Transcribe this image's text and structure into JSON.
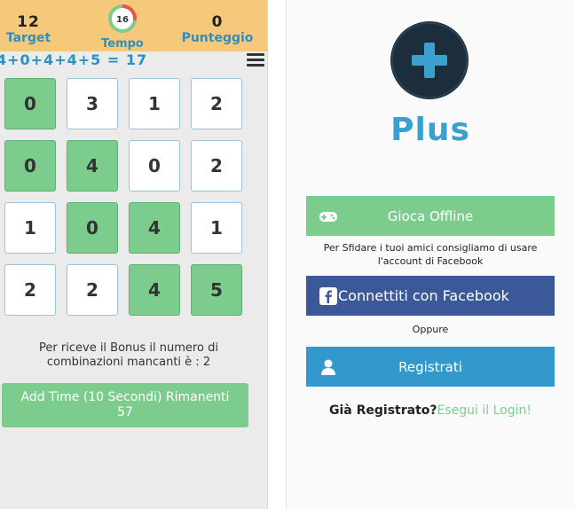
{
  "header": {
    "target_value": "12",
    "target_label": "Target",
    "timer_value": "16",
    "timer_label": "Tempo",
    "timer_fraction": 0.27,
    "score_value": "0",
    "score_label": "Punteggio"
  },
  "equation": "4+0+4+4+5 = 17",
  "grid": [
    [
      {
        "v": "0",
        "on": true
      },
      {
        "v": "3",
        "on": false
      },
      {
        "v": "1",
        "on": false
      },
      {
        "v": "2",
        "on": false
      }
    ],
    [
      {
        "v": "0",
        "on": true
      },
      {
        "v": "4",
        "on": true
      },
      {
        "v": "0",
        "on": false
      },
      {
        "v": "2",
        "on": false
      }
    ],
    [
      {
        "v": "1",
        "on": false
      },
      {
        "v": "0",
        "on": true
      },
      {
        "v": "4",
        "on": true
      },
      {
        "v": "1",
        "on": false
      }
    ],
    [
      {
        "v": "2",
        "on": false
      },
      {
        "v": "2",
        "on": false
      },
      {
        "v": "4",
        "on": true
      },
      {
        "v": "5",
        "on": true
      }
    ]
  ],
  "bonus": {
    "line1": "Per riceve il Bonus il numero di",
    "line2": "combinazioni mancanti è : 2"
  },
  "add_time": {
    "line1": "Add Time (10 Secondi) Rimanenti",
    "line2": "57"
  },
  "right": {
    "app_name": "Plus",
    "offline_button": "Gioca Offline",
    "offline_note_1": "Per Sfidare i tuoi amici consigliamo di usare",
    "offline_note_2": "l'account di Facebook",
    "facebook_button": "Connettiti con Facebook",
    "oppure": "Oppure",
    "register_button": "Registrati",
    "already_registered": "Già Registrato?",
    "login_link": "Esegui il Login!"
  },
  "colors": {
    "accent_blue": "#3399cc",
    "green": "#7ccd8d",
    "facebook": "#3b5998",
    "header_bg": "#f6c97a",
    "logo_bg": "#1c2e3b"
  }
}
